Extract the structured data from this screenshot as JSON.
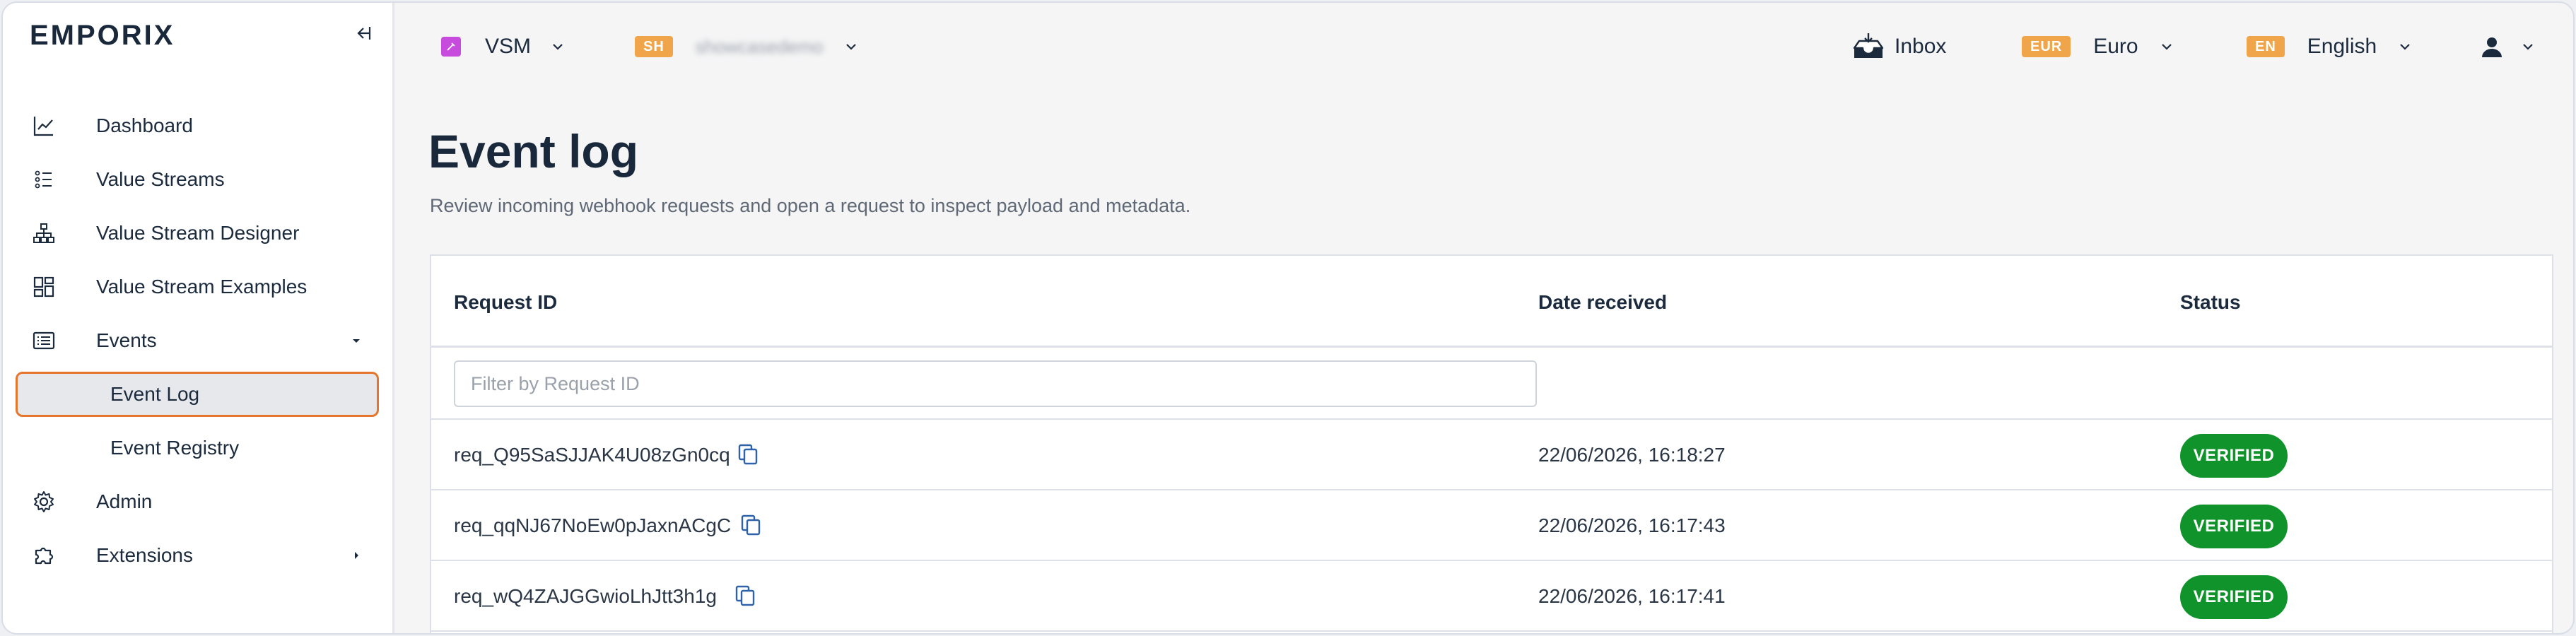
{
  "sidebar": {
    "brand": "EMPORIX",
    "items": [
      {
        "label": "Dashboard",
        "icon": "chart-line-icon"
      },
      {
        "label": "Value Streams",
        "icon": "list-numbered-icon"
      },
      {
        "label": "Value Stream Designer",
        "icon": "hierarchy-icon"
      },
      {
        "label": "Value Stream Examples",
        "icon": "dashboard-grid-icon"
      },
      {
        "label": "Events",
        "icon": "event-list-icon",
        "expanded": true
      },
      {
        "label": "Admin",
        "icon": "gear-icon"
      },
      {
        "label": "Extensions",
        "icon": "puzzle-icon"
      }
    ],
    "events_sub": [
      {
        "label": "Event Log",
        "active": true
      },
      {
        "label": "Event Registry",
        "active": false
      }
    ]
  },
  "topbar": {
    "workspace": "VSM",
    "tenant_tag": "SH",
    "tenant_name": "showcasedemo",
    "inbox": "Inbox",
    "currency_tag": "EUR",
    "currency": "Euro",
    "language_tag": "EN",
    "language": "English"
  },
  "page": {
    "title": "Event log",
    "subtitle": "Review incoming webhook requests and open a request to inspect payload and metadata."
  },
  "table": {
    "columns": [
      "Request ID",
      "Date received",
      "Status"
    ],
    "filter_placeholder": "Filter by Request ID",
    "rows": [
      {
        "id": "req_Q95SaSJJAK4U08zGn0cq",
        "date": "22/06/2026, 16:18:27",
        "status": "VERIFIED"
      },
      {
        "id": "req_qqNJ67NoEw0pJaxnACgC",
        "date": "22/06/2026, 16:17:43",
        "status": "VERIFIED"
      },
      {
        "id": "req_wQ4ZAJGGwioLhJtt3h1g",
        "date": "22/06/2026, 16:17:41",
        "status": "VERIFIED"
      }
    ]
  },
  "colors": {
    "accent": "#e5762c",
    "verified": "#11932b",
    "tag": "#f1a54a",
    "vsm": "#c74cdd"
  }
}
